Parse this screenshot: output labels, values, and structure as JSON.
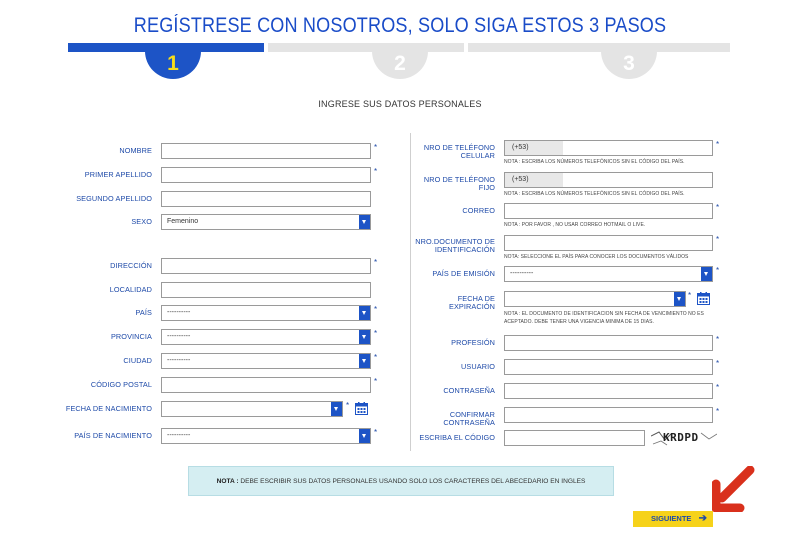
{
  "header": {
    "title": "REGÍSTRESE CON NOSOTROS, SOLO SIGA ESTOS 3 PASOS",
    "steps": [
      {
        "label": "1",
        "state": "active"
      },
      {
        "label": "2",
        "state": "inactive"
      },
      {
        "label": "3",
        "state": "inactive"
      }
    ],
    "subtitle": "INGRESE SUS DATOS PERSONALES"
  },
  "colors": {
    "primary": "#1d54c6",
    "accent_yellow": "#f6d21a",
    "step_inactive": "#e4e4e4",
    "nota_bg": "#d5eef2",
    "arrow_red": "#d9301c"
  },
  "left_form": {
    "nombre": {
      "label": "NOMBRE",
      "value": "",
      "required": "*"
    },
    "primer_apellido": {
      "label": "PRIMER APELLIDO",
      "value": "",
      "required": "*"
    },
    "segundo_apellido": {
      "label": "SEGUNDO APELLIDO",
      "value": ""
    },
    "sexo": {
      "label": "SEXO",
      "value": "Femenino"
    },
    "direccion": {
      "label": "DIRECCIÓN",
      "value": "",
      "required": "*"
    },
    "localidad": {
      "label": "LOCALIDAD",
      "value": ""
    },
    "pais": {
      "label": "PAÍS",
      "value": "----------",
      "required": "*"
    },
    "provincia": {
      "label": "PROVINCIA",
      "value": "----------",
      "required": "*"
    },
    "ciudad": {
      "label": "CIUDAD",
      "value": "----------",
      "required": "*"
    },
    "codigo_postal": {
      "label": "CÓDIGO POSTAL",
      "value": "",
      "required": "*"
    },
    "fecha_nacimiento": {
      "label": "FECHA DE NACIMIENTO",
      "value": "",
      "required": "*"
    },
    "pais_nacimiento": {
      "label": "PAÍS DE NACIMIENTO",
      "value": "----------",
      "required": "*"
    }
  },
  "right_form": {
    "tel_celular": {
      "label": "NRO DE TELÉFONO CELULAR",
      "prefix": "(+53)",
      "value": "",
      "required": "*",
      "note": "NOTA : ESCRIBA LOS NÚMEROS TELEFÓNICOS SIN EL CÓDIGO DEL PAÍS."
    },
    "tel_fijo": {
      "label": "NRO DE TELÉFONO FIJO",
      "prefix": "(+53)",
      "value": "",
      "note": "NOTA : ESCRIBA LOS NÚMEROS TELEFÓNICOS SIN EL CÓDIGO DEL PAÍS."
    },
    "correo": {
      "label": "CORREO",
      "value": "",
      "required": "*",
      "note": "NOTA : POR FAVOR , NO USAR CORREO HOTMAIL O LIVE."
    },
    "documento": {
      "label_line1": "NRO.DOCUMENTO DE",
      "label_line2": "IDENTIFICACIÓN",
      "value": "",
      "required": "*",
      "note": "NOTA: SELECCIONE EL PAÍS PARA CONOCER LOS DOCUMENTOS VÁLIDOS"
    },
    "pais_emision": {
      "label": "PAÍS DE EMISIÓN",
      "value": "----------",
      "required": "*"
    },
    "fecha_expiracion": {
      "label": "FECHA DE EXPIRACIÓN",
      "value": "",
      "required": "*",
      "note_line1": "NOTA : EL DOCUMENTO DE IDENTIFICACION SIN FECHA DE VENCIMIENTO NO ES",
      "note_line2": "ACEPTADO. DEBE TENER UNA VIGENCIA MINIMA DE 15 DIAS."
    },
    "profesion": {
      "label": "PROFESIÓN",
      "value": "",
      "required": "*"
    },
    "usuario": {
      "label": "USUARIO",
      "value": "",
      "required": "*"
    },
    "contrasena": {
      "label": "CONTRASEÑA",
      "value": "",
      "required": "*"
    },
    "confirmar_contrasena": {
      "label": "CONFIRMAR CONTRASEÑA",
      "value": "",
      "required": "*"
    },
    "codigo": {
      "label": "ESCRIBA EL CÓDIGO",
      "value": "",
      "captcha_text": "KRDPD"
    }
  },
  "footer": {
    "nota_bold": "NOTA :",
    "nota_text": " DEBE ESCRIBIR SUS DATOS PERSONALES USANDO SOLO LOS CARACTERES DEL ABECEDARIO EN INGLES",
    "next_label": "SIGUIENTE",
    "next_icon": "arrow-right-icon"
  }
}
